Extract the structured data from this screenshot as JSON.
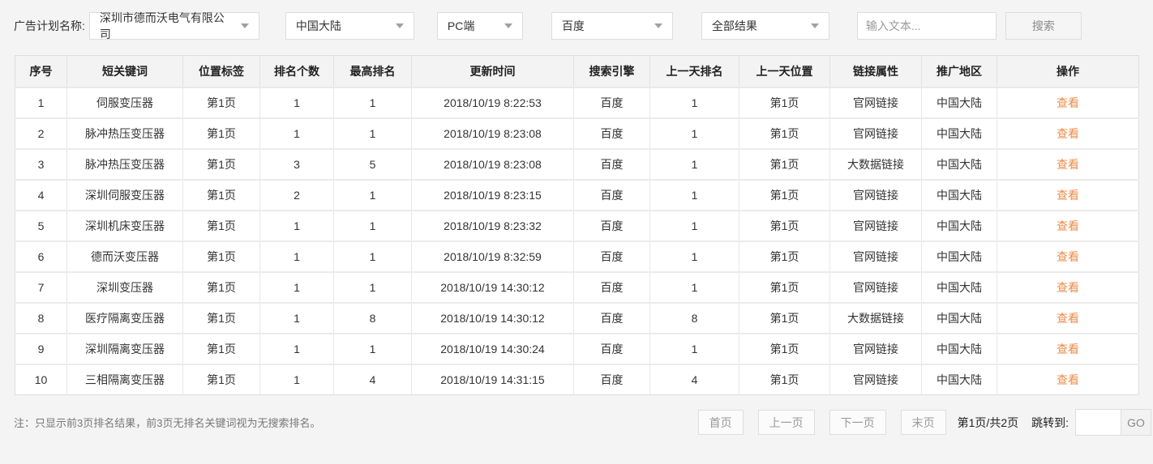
{
  "filters": {
    "label": "广告计划名称:",
    "plan_select": "深圳市德而沃电气有限公司",
    "region_select": "中国大陆",
    "device_select": "PC端",
    "engine_select": "百度",
    "result_select": "全部结果",
    "search_placeholder": "输入文本...",
    "search_button": "搜索"
  },
  "table": {
    "headers": [
      "序号",
      "短关键词",
      "位置标签",
      "排名个数",
      "最高排名",
      "更新时间",
      "搜索引擎",
      "上一天排名",
      "上一天位置",
      "链接属性",
      "推广地区",
      "操作"
    ],
    "action_label": "查看",
    "rows": [
      [
        "1",
        "伺服变压器",
        "第1页",
        "1",
        "1",
        "2018/10/19 8:22:53",
        "百度",
        "1",
        "第1页",
        "官网链接",
        "中国大陆"
      ],
      [
        "2",
        "脉冲热压变压器",
        "第1页",
        "1",
        "1",
        "2018/10/19 8:23:08",
        "百度",
        "1",
        "第1页",
        "官网链接",
        "中国大陆"
      ],
      [
        "3",
        "脉冲热压变压器",
        "第1页",
        "3",
        "5",
        "2018/10/19 8:23:08",
        "百度",
        "1",
        "第1页",
        "大数据链接",
        "中国大陆"
      ],
      [
        "4",
        "深圳伺服变压器",
        "第1页",
        "2",
        "1",
        "2018/10/19 8:23:15",
        "百度",
        "1",
        "第1页",
        "官网链接",
        "中国大陆"
      ],
      [
        "5",
        "深圳机床变压器",
        "第1页",
        "1",
        "1",
        "2018/10/19 8:23:32",
        "百度",
        "1",
        "第1页",
        "官网链接",
        "中国大陆"
      ],
      [
        "6",
        "德而沃变压器",
        "第1页",
        "1",
        "1",
        "2018/10/19 8:32:59",
        "百度",
        "1",
        "第1页",
        "官网链接",
        "中国大陆"
      ],
      [
        "7",
        "深圳变压器",
        "第1页",
        "1",
        "1",
        "2018/10/19 14:30:12",
        "百度",
        "1",
        "第1页",
        "官网链接",
        "中国大陆"
      ],
      [
        "8",
        "医疗隔离变压器",
        "第1页",
        "1",
        "8",
        "2018/10/19 14:30:12",
        "百度",
        "8",
        "第1页",
        "大数据链接",
        "中国大陆"
      ],
      [
        "9",
        "深圳隔离变压器",
        "第1页",
        "1",
        "1",
        "2018/10/19 14:30:24",
        "百度",
        "1",
        "第1页",
        "官网链接",
        "中国大陆"
      ],
      [
        "10",
        "三相隔离变压器",
        "第1页",
        "1",
        "4",
        "2018/10/19 14:31:15",
        "百度",
        "4",
        "第1页",
        "官网链接",
        "中国大陆"
      ]
    ]
  },
  "footer": {
    "note": "注：只显示前3页排名结果，前3页无排名关键词视为无搜索排名。",
    "pagination": {
      "first": "首页",
      "prev": "上一页",
      "next": "下一页",
      "last": "末页",
      "page_info": "第1页/共2页",
      "jump_label": "跳转到:",
      "go_button": "GO"
    }
  },
  "colors": {
    "accent_link": "#ed8c4a",
    "header_bg": "#f3f3f3",
    "page_bg": "#f4f4f4"
  }
}
